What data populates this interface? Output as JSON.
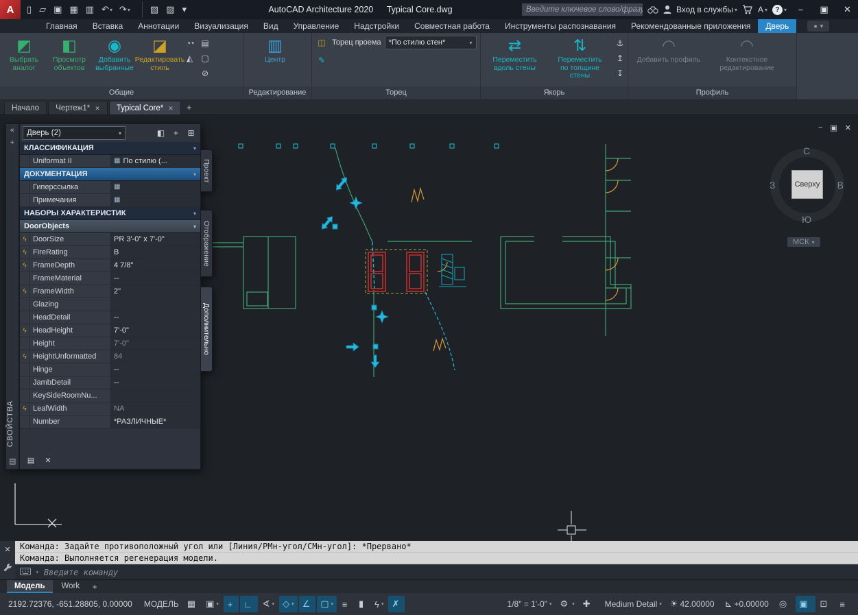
{
  "glyphs": {
    "caret": "▾",
    "close": "✕",
    "minimize": "−",
    "restore": "▣",
    "plus": "+",
    "circle": "●"
  },
  "titlebar": {
    "logo": "A",
    "app_title": "AutoCAD Architecture 2020",
    "doc_title": "Typical Core.dwg",
    "search_placeholder": "Введите ключевое слово/фразу",
    "signin_label": "Вход в службы",
    "appstore_label": "А",
    "help_label": "?",
    "quick_access": [
      {
        "name": "new-file-icon",
        "glyph": "▯"
      },
      {
        "name": "open-file-icon",
        "glyph": "▱"
      },
      {
        "name": "save-icon",
        "glyph": "▣"
      },
      {
        "name": "save-as-icon",
        "glyph": "▦"
      },
      {
        "name": "plot-icon",
        "glyph": "▥"
      },
      {
        "name": "undo-icon",
        "glyph": "↶",
        "caret": "▾"
      },
      {
        "name": "redo-icon",
        "glyph": "↷",
        "caret": "▾"
      },
      {
        "name": "sheet-set-manager-icon",
        "glyph": "▧",
        "cls": "gap"
      },
      {
        "name": "layer-properties-icon",
        "glyph": "▨"
      },
      {
        "name": "qat-customize-icon",
        "glyph": "▾"
      }
    ]
  },
  "ribbon": {
    "tabs": [
      {
        "label": "Главная"
      },
      {
        "label": "Вставка"
      },
      {
        "label": "Аннотации"
      },
      {
        "label": "Визуализация"
      },
      {
        "label": "Вид"
      },
      {
        "label": "Управление"
      },
      {
        "label": "Надстройки"
      },
      {
        "label": "Совместная работа"
      },
      {
        "label": "Инструменты распознавания"
      },
      {
        "label": "Рекомендованные приложения"
      },
      {
        "label": "Дверь",
        "active": true
      }
    ],
    "panels": {
      "general": {
        "label": "Общие",
        "large": [
          {
            "name": "select-similar-button",
            "glyph": "◩",
            "cls": "ic-green",
            "l1": "Выбрать",
            "l2": "аналог"
          },
          {
            "name": "object-viewer-button",
            "glyph": "◧",
            "cls": "ic-green",
            "l1": "Просмотр",
            "l2": "объектов"
          },
          {
            "name": "add-selected-button",
            "glyph": "◉",
            "cls": "ic-teal",
            "l1": "Добавить",
            "l2": "выбранные"
          },
          {
            "name": "edit-style-button",
            "glyph": "◪",
            "cls": "ic-tan",
            "l1": "Редактировать",
            "l2": "стиль"
          }
        ],
        "small_a": [
          {
            "name": "visibility-flyout-icon",
            "glyph": "◔",
            "caret": "▾"
          },
          {
            "name": "hide-objects-icon",
            "glyph": "◭"
          }
        ],
        "small_b": [
          {
            "name": "style-manager-icon",
            "glyph": "▤"
          },
          {
            "name": "copy-style-icon",
            "glyph": "▢"
          },
          {
            "name": "purge-style-icon",
            "glyph": "⊘"
          }
        ]
      },
      "edit": {
        "label": "Редактирование",
        "large": [
          {
            "name": "center-button",
            "glyph": "▥",
            "cls": "ic-blue",
            "l1": "Центр",
            "l2": ""
          }
        ]
      },
      "endcap": {
        "label": "Торец",
        "row_icon_glyph": "◫",
        "row_label": "Торец проема",
        "select_value": "*По стилю стен*",
        "brush_glyph": "✎"
      },
      "anchor": {
        "label": "Якорь",
        "large": [
          {
            "name": "move-along-wall-button",
            "glyph": "⇄",
            "cls": "ic-teal",
            "l1": "Переместить",
            "l2": "вдоль стены"
          },
          {
            "name": "move-across-wall-button",
            "glyph": "⇅",
            "cls": "ic-teal",
            "l1": "Переместить",
            "l2": "по толщине стены"
          }
        ],
        "small": [
          {
            "name": "anchor-set-icon",
            "glyph": "⚓"
          },
          {
            "name": "anchor-release-icon",
            "glyph": "↥"
          },
          {
            "name": "anchor-flip-icon",
            "glyph": "↧"
          }
        ]
      },
      "profile": {
        "label": "Профиль",
        "large": [
          {
            "name": "add-profile-button",
            "glyph": "◠",
            "cls": "ic-gray",
            "l1": "Добавить профиль",
            "l2": "",
            "disabled": true
          },
          {
            "name": "context-edit-button",
            "glyph": "◠",
            "cls": "ic-gray",
            "l1": "Контекстное",
            "l2": "редактирование",
            "disabled": true
          }
        ]
      }
    }
  },
  "file_tabs": {
    "tabs": [
      {
        "label": "Начало"
      },
      {
        "label": "Чертеж1*",
        "closable": true
      },
      {
        "label": "Typical Core*",
        "closable": true,
        "active": true
      }
    ]
  },
  "drawing_window": {
    "min": "−",
    "restore": "▣",
    "close": "✕"
  },
  "viewcube": {
    "north": "С",
    "south": "Ю",
    "west": "З",
    "east": "В",
    "face": "Сверху",
    "ucs": "МСК"
  },
  "properties": {
    "palette_title": "СВОЙСТВА",
    "selection_label": "Дверь (2)",
    "rail": [
      {
        "name": "palette-autohide-icon",
        "glyph": "«"
      },
      {
        "name": "palette-pin-icon",
        "glyph": "+"
      }
    ],
    "rail_menu_glyph": "▤",
    "tools": [
      {
        "name": "quick-select-icon",
        "glyph": "◧",
        "cls": "ic-teal"
      },
      {
        "name": "select-objects-icon",
        "glyph": "+"
      },
      {
        "name": "toggle-pickadd-icon",
        "glyph": "⊞"
      }
    ],
    "sections": {
      "classification": "КЛАССИФИКАЦИЯ",
      "documentation": "ДОКУМЕНТАЦИЯ",
      "property_sets": "НАБОРЫ ХАРАКТЕРИСТИК",
      "category": "DoorObjects"
    },
    "classification_rows": [
      {
        "label": "Uniformat II",
        "value": "По стилю (...",
        "vicon": "▦"
      }
    ],
    "documentation_rows": [
      {
        "label": "Гиперссылка",
        "value": "",
        "vicon": "▦"
      },
      {
        "label": "Примечания",
        "value": "",
        "vicon": "▦"
      }
    ],
    "door_rows": [
      {
        "bolt": "ϟ",
        "label": "DoorSize",
        "value": "PR 3'-0\" x 7'-0\""
      },
      {
        "bolt": "ϟ",
        "label": "FireRating",
        "value": "B"
      },
      {
        "bolt": "ϟ",
        "label": "FrameDepth",
        "value": "4 7/8\""
      },
      {
        "label": "FrameMaterial",
        "value": "--"
      },
      {
        "bolt": "ϟ",
        "label": "FrameWidth",
        "value": "2\""
      },
      {
        "label": "Glazing",
        "value": ""
      },
      {
        "label": "HeadDetail",
        "value": "--"
      },
      {
        "bolt": "ϟ",
        "label": "HeadHeight",
        "value": "7'-0\""
      },
      {
        "label": "Height",
        "value": "7'-0\"",
        "muted": true
      },
      {
        "bolt": "ϟ",
        "label": "HeightUnformatted",
        "value": "84",
        "muted": true
      },
      {
        "label": "Hinge",
        "value": "--"
      },
      {
        "label": "JambDetail",
        "value": "--"
      },
      {
        "label": "KeySideRoomNu...",
        "value": ""
      },
      {
        "bolt": "ϟ",
        "label": "LeafWidth",
        "value": "NA",
        "muted": true
      },
      {
        "label": "Number",
        "value": "*РАЗЛИЧНЫЕ*"
      }
    ],
    "bottom": [
      {
        "name": "property-data-icon",
        "glyph": "▤"
      },
      {
        "name": "remove-filter-icon",
        "glyph": "✕",
        "cls": "ic-red"
      }
    ],
    "side_tabs": [
      {
        "label": "Проект"
      },
      {
        "label": "Отображение"
      },
      {
        "label": "Дополнительно",
        "active": true
      }
    ]
  },
  "command": {
    "history": [
      "Команда: Задайте противоположный угол или [Линия/РМн-угол/СМн-угол]: *Прервано*",
      "Команда: Выполняется регенерация модели."
    ],
    "prompt": "Введите команду"
  },
  "model_tabs": {
    "tabs": [
      {
        "label": "Модель",
        "active": true
      },
      {
        "label": "Work"
      }
    ]
  },
  "statusbar": {
    "coords": "2192.72376, -651.28805, 0.00000",
    "model_label": "МОДЕЛЬ",
    "left_icons": [
      {
        "name": "grid-display-icon",
        "glyph": "▦"
      },
      {
        "name": "snap-mode-icon",
        "glyph": "▣",
        "caret": "▾"
      },
      {
        "name": "dynamic-input-icon",
        "glyph": "+",
        "active": true
      },
      {
        "name": "ortho-mode-icon",
        "glyph": "∟",
        "active": true
      },
      {
        "name": "polar-tracking-icon",
        "glyph": "∢",
        "caret": "▾"
      },
      {
        "name": "isometric-drafting-icon",
        "glyph": "◇",
        "caret": "▾",
        "active": true
      },
      {
        "name": "osnap-tracking-icon",
        "glyph": "∠",
        "active": true
      },
      {
        "name": "object-snap-icon",
        "glyph": "▢",
        "caret": "▾",
        "active": true
      },
      {
        "name": "lineweight-icon",
        "glyph": "≡"
      },
      {
        "name": "selection-cycling-icon",
        "glyph": "▮",
        "cls": "ic-green"
      },
      {
        "name": "annotation-monitor-icon",
        "glyph": "ϟ",
        "caret": "▾"
      },
      {
        "name": "3d-osnap-icon",
        "glyph": "✗",
        "active": true
      }
    ],
    "right_items": [
      {
        "name": "annotation-scale-button",
        "label": "1/8\" = 1'-0\"",
        "caret": "▾"
      },
      {
        "name": "annotation-tools-icon",
        "glyph": "⚙",
        "caret": "▾"
      },
      {
        "name": "add-annotation-scales-icon",
        "glyph": "✚"
      },
      {
        "name": "detail-level-button",
        "label": "Medium Detail",
        "caret": "▾"
      },
      {
        "name": "surface-brightness-button",
        "glyph": "☀",
        "label": "42.00000"
      },
      {
        "name": "elevation-button",
        "glyph": "⊾",
        "label": "+0.00000"
      },
      {
        "name": "object-isolate-icon",
        "glyph": "◎"
      },
      {
        "name": "graphics-performance-icon",
        "glyph": "▣",
        "active": true
      },
      {
        "name": "clean-screen-icon",
        "glyph": "⊡"
      },
      {
        "name": "customization-icon",
        "glyph": "≡"
      }
    ]
  }
}
